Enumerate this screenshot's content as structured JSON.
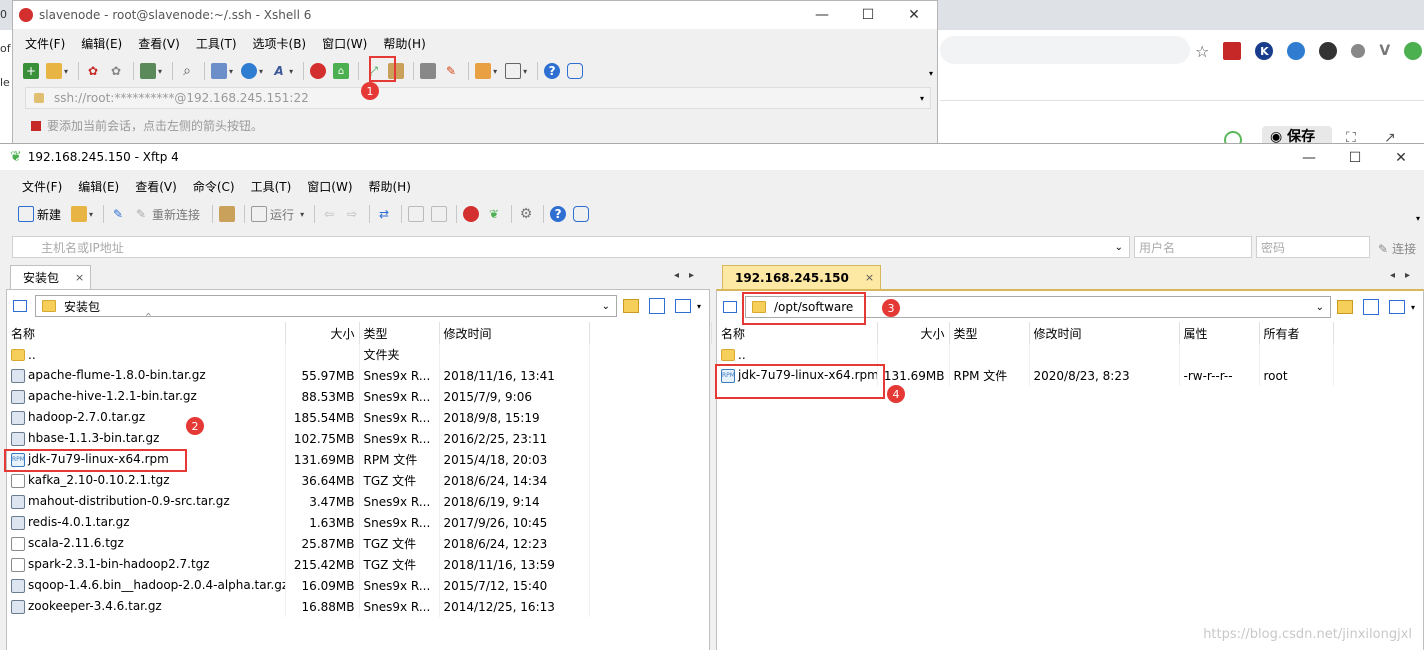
{
  "browser": {
    "left_edge_chars": [
      "0",
      "of",
      "le"
    ],
    "save_label": "保存"
  },
  "xshell": {
    "title": "slavenode - root@slavenode:~/.ssh - Xshell 6",
    "menu": [
      "文件(F)",
      "编辑(E)",
      "查看(V)",
      "工具(T)",
      "选项卡(B)",
      "窗口(W)",
      "帮助(H)"
    ],
    "address": "ssh://root:**********@192.168.245.151:22",
    "hint": "要添加当前会话，点击左侧的箭头按钮。",
    "badge1": "1"
  },
  "xftp": {
    "title": "192.168.245.150 - Xftp 4",
    "menu": [
      "文件(F)",
      "编辑(E)",
      "查看(V)",
      "命令(C)",
      "工具(T)",
      "窗口(W)",
      "帮助(H)"
    ],
    "toolbar": {
      "new_label": "新建",
      "reconnect_label": "重新连接",
      "run_label": "运行"
    },
    "host_placeholder": "主机名或IP地址",
    "user_placeholder": "用户名",
    "password_placeholder": "密码",
    "connect_label": "连接",
    "local": {
      "tab": "安装包",
      "path": "安装包",
      "columns": [
        "名称",
        "大小",
        "类型",
        "修改时间"
      ],
      "files": [
        {
          "name": "..",
          "size": "",
          "type": "文件夹",
          "mtime": "",
          "icon": "folder"
        },
        {
          "name": "apache-flume-1.8.0-bin.tar.gz",
          "size": "55.97MB",
          "type": "Snes9x R...",
          "mtime": "2018/11/16, 13:41",
          "icon": "archive"
        },
        {
          "name": "apache-hive-1.2.1-bin.tar.gz",
          "size": "88.53MB",
          "type": "Snes9x R...",
          "mtime": "2015/7/9, 9:06",
          "icon": "archive"
        },
        {
          "name": "hadoop-2.7.0.tar.gz",
          "size": "185.54MB",
          "type": "Snes9x R...",
          "mtime": "2018/9/8, 15:19",
          "icon": "archive"
        },
        {
          "name": "hbase-1.1.3-bin.tar.gz",
          "size": "102.75MB",
          "type": "Snes9x R...",
          "mtime": "2016/2/25, 23:11",
          "icon": "archive"
        },
        {
          "name": "jdk-7u79-linux-x64.rpm",
          "size": "131.69MB",
          "type": "RPM 文件",
          "mtime": "2015/4/18, 20:03",
          "icon": "rpm"
        },
        {
          "name": "kafka_2.10-0.10.2.1.tgz",
          "size": "36.64MB",
          "type": "TGZ 文件",
          "mtime": "2018/6/24, 14:34",
          "icon": "plain"
        },
        {
          "name": "mahout-distribution-0.9-src.tar.gz",
          "size": "3.47MB",
          "type": "Snes9x R...",
          "mtime": "2018/6/19, 9:14",
          "icon": "archive"
        },
        {
          "name": "redis-4.0.1.tar.gz",
          "size": "1.63MB",
          "type": "Snes9x R...",
          "mtime": "2017/9/26, 10:45",
          "icon": "archive"
        },
        {
          "name": "scala-2.11.6.tgz",
          "size": "25.87MB",
          "type": "TGZ 文件",
          "mtime": "2018/6/24, 12:23",
          "icon": "plain"
        },
        {
          "name": "spark-2.3.1-bin-hadoop2.7.tgz",
          "size": "215.42MB",
          "type": "TGZ 文件",
          "mtime": "2018/11/16, 13:59",
          "icon": "plain"
        },
        {
          "name": "sqoop-1.4.6.bin__hadoop-2.0.4-alpha.tar.gz",
          "size": "16.09MB",
          "type": "Snes9x R...",
          "mtime": "2015/7/12, 15:40",
          "icon": "archive"
        },
        {
          "name": "zookeeper-3.4.6.tar.gz",
          "size": "16.88MB",
          "type": "Snes9x R...",
          "mtime": "2014/12/25, 16:13",
          "icon": "archive"
        }
      ],
      "badge2": "2"
    },
    "remote": {
      "tab": "192.168.245.150",
      "path": "/opt/software",
      "columns": [
        "名称",
        "大小",
        "类型",
        "修改时间",
        "属性",
        "所有者"
      ],
      "files": [
        {
          "name": "..",
          "size": "",
          "type": "",
          "mtime": "",
          "attr": "",
          "owner": "",
          "icon": "folder"
        },
        {
          "name": "jdk-7u79-linux-x64.rpm",
          "size": "131.69MB",
          "type": "RPM 文件",
          "mtime": "2020/8/23, 8:23",
          "attr": "-rw-r--r--",
          "owner": "root",
          "icon": "rpm"
        }
      ],
      "badge3": "3",
      "badge4": "4"
    },
    "watermark": "https://blog.csdn.net/jinxilongjxl"
  }
}
